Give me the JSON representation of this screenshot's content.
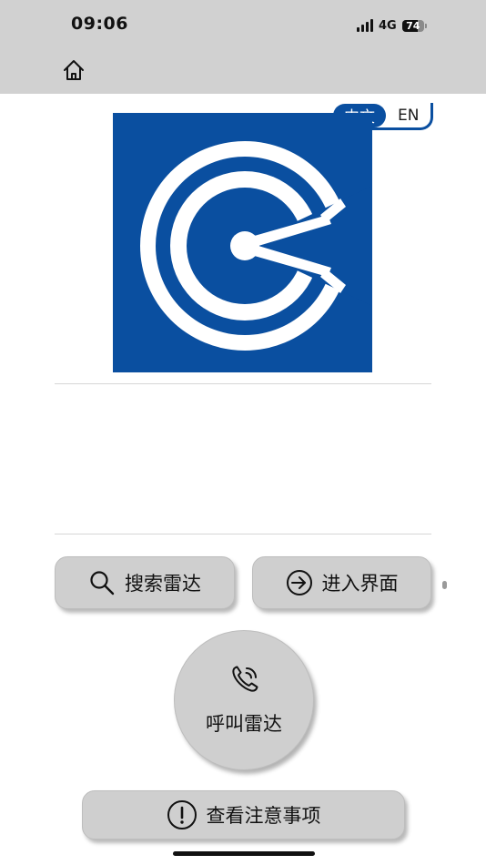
{
  "status_bar": {
    "time": "09:06",
    "network": "4G",
    "battery_percent": "74",
    "battery_level": 0.74
  },
  "nav": {
    "home_icon": "home-icon"
  },
  "language": {
    "zh_label": "中文",
    "en_label": "EN",
    "selected": "zh"
  },
  "brand": {
    "logo_color": "#0a4fa0",
    "logo_icon": "company-logo-icon"
  },
  "buttons": {
    "search_radar": {
      "label": "搜索雷达",
      "icon": "search-icon"
    },
    "enter_interface": {
      "label": "进入界面",
      "icon": "enter-arrow-icon"
    },
    "call_radar": {
      "label": "呼叫雷达",
      "icon": "phone-call-icon"
    },
    "view_notes": {
      "label": "查看注意事项",
      "icon": "exclamation-circle-icon"
    }
  }
}
